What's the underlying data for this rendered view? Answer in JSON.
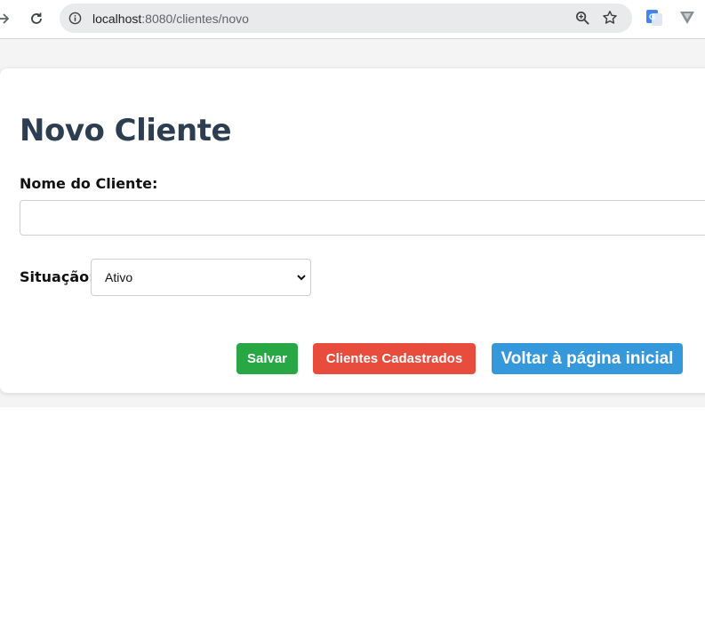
{
  "browser": {
    "url_host": "localhost",
    "url_rest": ":8080/clientes/novo"
  },
  "form": {
    "title": "Novo Cliente",
    "name_label": "Nome do Cliente:",
    "name_value": "",
    "status_label": "Situação:",
    "status_value": "Ativo"
  },
  "buttons": {
    "save": "Salvar",
    "clients": "Clientes Cadastrados",
    "home": "Voltar à página inicial"
  },
  "colors": {
    "title": "#2c3e50",
    "save": "#28a745",
    "clients": "#e74c3c",
    "home": "#3498db"
  }
}
